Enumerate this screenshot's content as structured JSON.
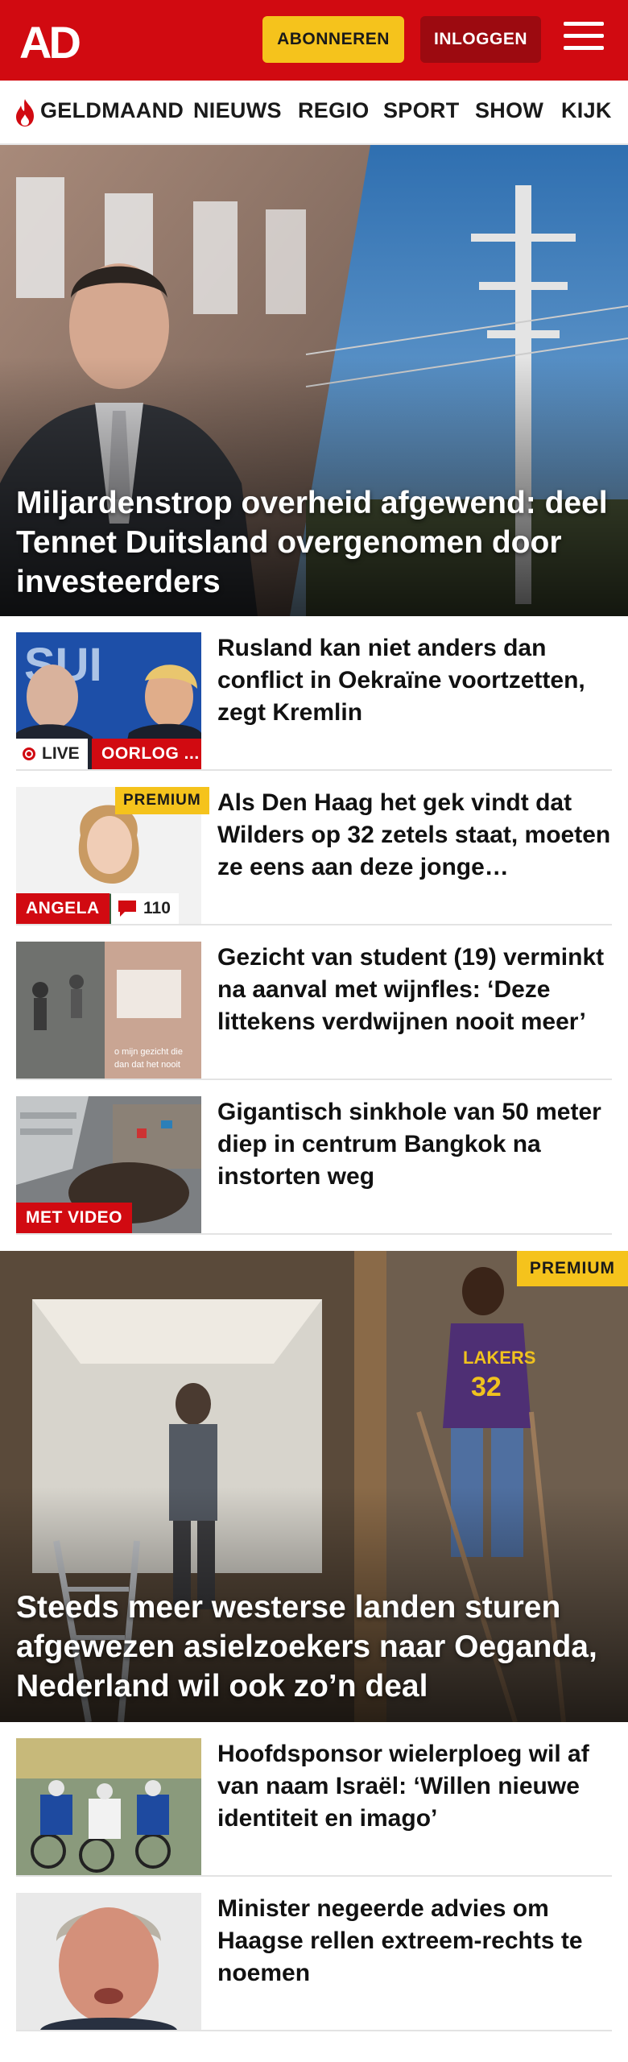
{
  "header": {
    "logo_text": "AD",
    "subscribe_label": "ABONNEREN",
    "login_label": "INLOGGEN",
    "menu_icon": "hamburger-menu-icon",
    "brand_color": "#d10a11"
  },
  "nav": {
    "items": [
      {
        "label": "GELDMAAND",
        "icon": "flame-icon"
      },
      {
        "label": "NIEUWS"
      },
      {
        "label": "REGIO"
      },
      {
        "label": "SPORT"
      },
      {
        "label": "SHOW"
      },
      {
        "label": "KIJK"
      }
    ]
  },
  "hero1": {
    "title": "Miljardenstrop overheid afgewend: deel Tennet Duitsland overgenomen door investeerders"
  },
  "articles1": [
    {
      "title": "Rusland kan niet anders dan conflict in Oekraïne voortzetten, zegt Kremlin",
      "live_label": "LIVE",
      "tag": "OORLOG ..."
    },
    {
      "title": "Als Den Haag het gek vindt dat Wilders op 32 zetels staat, moeten ze eens aan deze jonge…",
      "premium": "PREMIUM",
      "tag": "ANGELA",
      "comments": "110"
    },
    {
      "title": "Gezicht van student (19) verminkt na aanval met wijnfles: ‘Deze littekens verdwijnen nooit meer’"
    },
    {
      "title": "Gigantisch sinkhole van 50 meter diep in centrum Bangkok na instorten weg",
      "tag": "MET VIDEO"
    }
  ],
  "hero2": {
    "title": "Steeds meer westerse landen sturen afgewezen asielzoekers naar Oeganda, Nederland wil ook zo’n deal",
    "premium": "PREMIUM"
  },
  "articles2": [
    {
      "title": "Hoofdsponsor wielerploeg wil af van naam Israël: ‘Willen nieuwe identiteit en imago’"
    },
    {
      "title": "Minister negeerde advies om Haagse rellen extreem-rechts te noemen"
    }
  ]
}
